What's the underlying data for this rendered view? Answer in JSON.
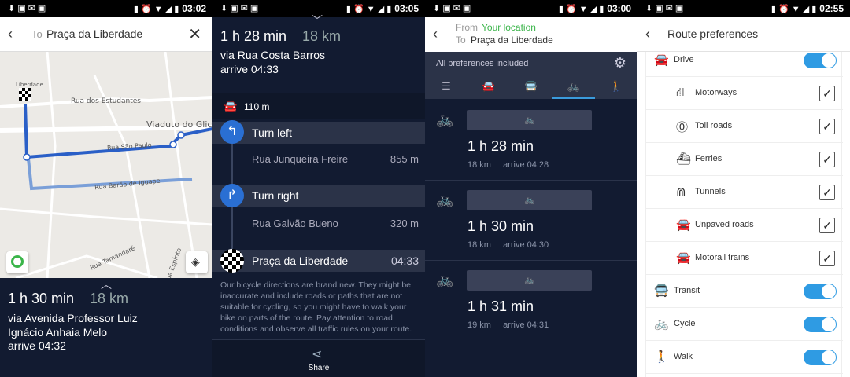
{
  "status_bars": [
    {
      "time": "03:02",
      "left_icons": "⬇▣✉▣",
      "right_icons": "▮ ⏰ ▼ ◢ ▮"
    },
    {
      "time": "03:05",
      "left_icons": "⬇▣✉▣",
      "right_icons": "▮ ⏰ ▼ ◢ ▮"
    },
    {
      "time": "03:00",
      "left_icons": "⬇▣✉▣",
      "right_icons": "▮ ⏰ ▼ ◢ ▮"
    },
    {
      "time": "02:55",
      "left_icons": "⬇▣✉▣",
      "right_icons": "▮ ⏰ ▼ ◢ ▮"
    }
  ],
  "panel1": {
    "to_label": "To",
    "destination": "Praça da Liberdade",
    "map_labels": {
      "liberdade": "Liberdade",
      "estudantes": "Rua dos Estudantes",
      "viaduto": "Viaduto do Glicé",
      "sao_paulo": "Rua São Paulo",
      "barao": "Rua Barão de Iguape",
      "tamandare": "Rua Tamandaré",
      "espirito": "Rua Espírito"
    },
    "duration": "1 h 30 min",
    "distance": "18 km",
    "via": "via Avenida Professor Luiz Ignácio Anhaia Melo",
    "arrive": "arrive 04:32",
    "colors": {
      "route": "#2a5fc7",
      "route_alt": "#7a9fd8"
    }
  },
  "panel2": {
    "duration": "1 h 28 min",
    "distance": "18 km",
    "via": "via Rua Costa Barros",
    "arrive": "arrive 04:33",
    "car_distance": "110 m",
    "steps": [
      {
        "instruction": "Turn left",
        "street": "Rua Junqueira Freire",
        "distance": "855 m"
      },
      {
        "instruction": "Turn right",
        "street": "Rua Galvão Bueno",
        "distance": "320 m"
      }
    ],
    "destination": {
      "label": "Praça da Liberdade",
      "time": "04:33"
    },
    "note": "Our bicycle directions are brand new. They might be inaccurate and include roads or paths that are not suitable for cycling, so you might have to walk your bike on parts of the route. Pay attention to road conditions and observe all traffic rules on your route.",
    "share_label": "Share"
  },
  "panel3": {
    "from_label": "From",
    "from_value": "Your location",
    "to_label": "To",
    "to_value": "Praça da Liberdade",
    "prefs_text": "All preferences included",
    "routes": [
      {
        "duration": "1 h 28 min",
        "distance": "18 km",
        "arrive": "arrive 04:28"
      },
      {
        "duration": "1 h 30 min",
        "distance": "18 km",
        "arrive": "arrive 04:30"
      },
      {
        "duration": "1 h 31 min",
        "distance": "19 km",
        "arrive": "arrive 04:31"
      }
    ],
    "accent": "#3bb54a"
  },
  "panel4": {
    "title": "Route preferences",
    "drive": "Drive",
    "sub_items": [
      "Motorways",
      "Toll roads",
      "Ferries",
      "Tunnels",
      "Unpaved roads",
      "Motorail trains"
    ],
    "transit": "Transit",
    "cycle": "Cycle",
    "walk": "Walk",
    "toggle_color": "#2f9be3"
  }
}
